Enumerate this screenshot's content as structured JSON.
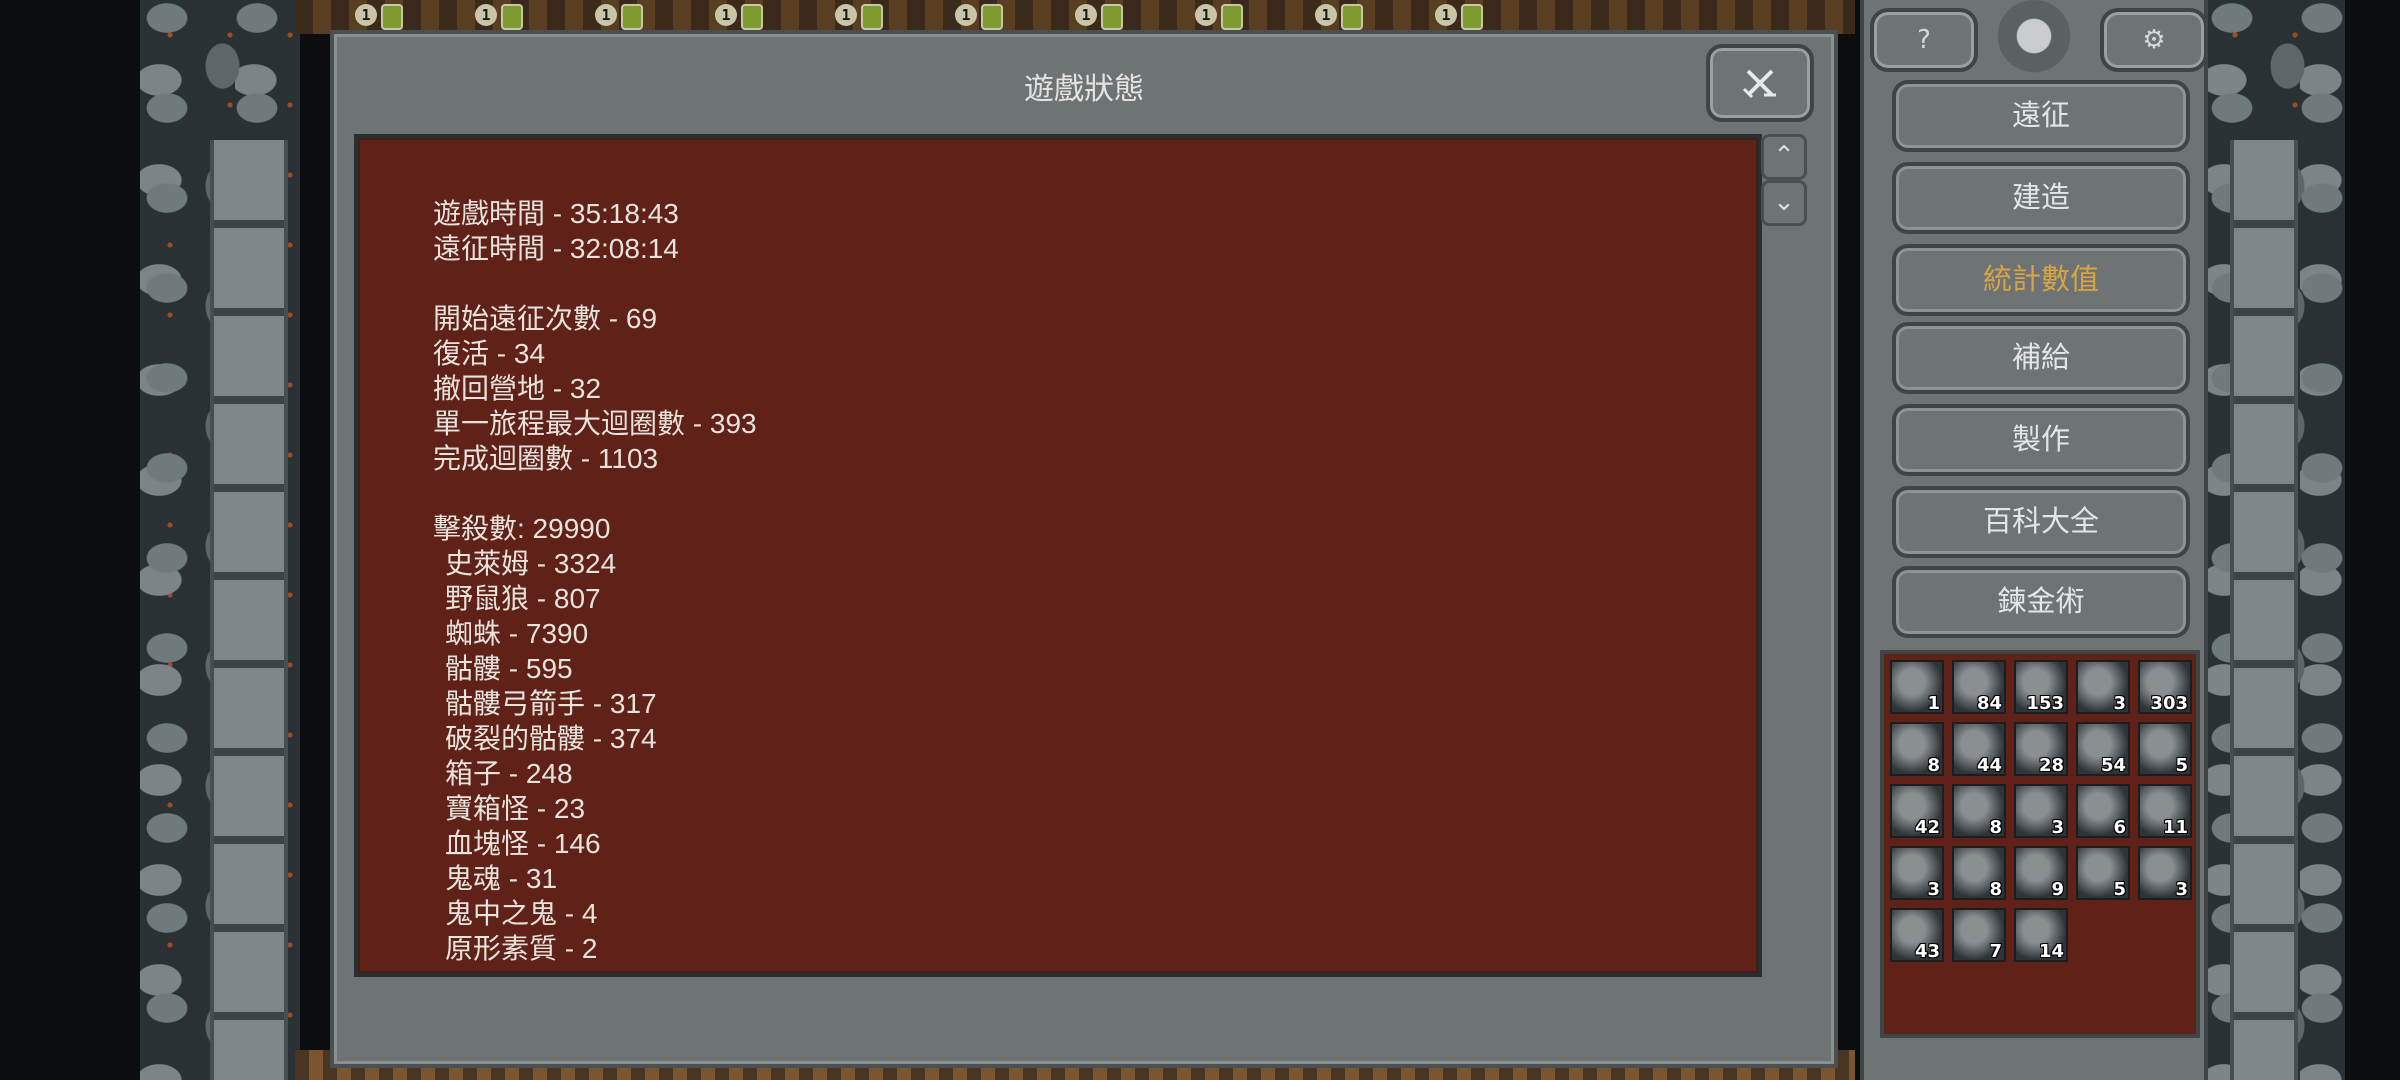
{
  "dialog": {
    "title": "遊戲狀態",
    "close_icon": "crossed-swords-icon"
  },
  "stats": {
    "play_time": "遊戲時間 - 35:18:43",
    "expedition_time": "遠征時間 - 32:08:14",
    "expeditions_started": "開始遠征次數 - 69",
    "revives": "復活 - 34",
    "retreats": "撤回營地 - 32",
    "max_loops": "單一旅程最大迴圈數 - 393",
    "loops_completed": "完成迴圈數 - 1103",
    "kills_total": "擊殺數:  29990",
    "kills": [
      "史萊姆 - 3324",
      "野鼠狼 - 807",
      "蜘蛛 - 7390",
      "骷髏 - 595",
      "骷髏弓箭手 - 317",
      "破裂的骷髏 - 374",
      "箱子 - 248",
      "寶箱怪 - 23",
      "血塊怪 - 146",
      "鬼魂 - 31",
      "鬼中之鬼 - 4",
      "原形素質 - 2"
    ]
  },
  "scroll": {
    "up_icon": "chevron-up-icon",
    "down_icon": "chevron-down-icon"
  },
  "panel": {
    "help_icon": "help-elephant-icon",
    "settings_icon": "gear-icon",
    "emblem_icon": "skull-emblem-icon",
    "menu": [
      {
        "label": "遠征",
        "active": false
      },
      {
        "label": "建造",
        "active": false
      },
      {
        "label": "統計數值",
        "active": true
      },
      {
        "label": "補給",
        "active": false
      },
      {
        "label": "製作",
        "active": false
      },
      {
        "label": "百科大全",
        "active": false
      },
      {
        "label": "鍊金術",
        "active": false
      }
    ],
    "active_color": "#d9a441"
  },
  "inventory": [
    [
      {
        "count": "1"
      },
      {
        "count": "84"
      },
      {
        "count": "153"
      },
      {
        "count": "3"
      },
      {
        "count": "303"
      }
    ],
    [
      {
        "count": "8"
      },
      {
        "count": "44"
      },
      {
        "count": "28"
      },
      {
        "count": "54"
      },
      {
        "count": "5"
      }
    ],
    [
      {
        "count": "42"
      },
      {
        "count": "8"
      },
      {
        "count": "3"
      },
      {
        "count": "6"
      },
      {
        "count": "11"
      }
    ],
    [
      {
        "count": "3"
      },
      {
        "count": "8"
      },
      {
        "count": "9"
      },
      {
        "count": "5"
      },
      {
        "count": "3"
      }
    ],
    [
      {
        "count": "43"
      },
      {
        "count": "7"
      },
      {
        "count": "14"
      }
    ]
  ],
  "map_tile_badge": "1"
}
